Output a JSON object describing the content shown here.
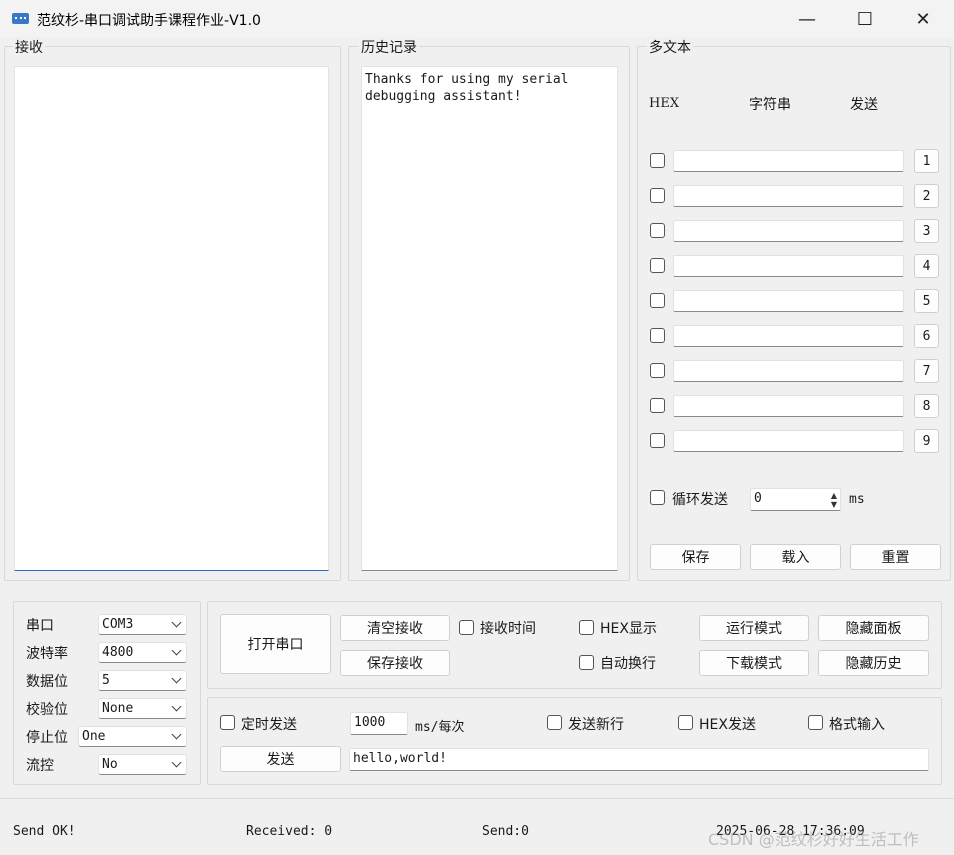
{
  "window": {
    "title": "范纹杉-串口调试助手课程作业-V1.0",
    "minimize": "—",
    "maximize": "☐",
    "close": "✕"
  },
  "receive": {
    "label": "接收",
    "content": ""
  },
  "history": {
    "label": "历史记录",
    "content": "Thanks for using my serial\ndebugging assistant!"
  },
  "multitext": {
    "label": "多文本",
    "col_hex": "HEX",
    "col_string": "字符串",
    "col_send": "发送",
    "rows": [
      {
        "num": "1",
        "value": ""
      },
      {
        "num": "2",
        "value": ""
      },
      {
        "num": "3",
        "value": ""
      },
      {
        "num": "4",
        "value": ""
      },
      {
        "num": "5",
        "value": ""
      },
      {
        "num": "6",
        "value": ""
      },
      {
        "num": "7",
        "value": ""
      },
      {
        "num": "8",
        "value": ""
      },
      {
        "num": "9",
        "value": ""
      }
    ],
    "loop_send_label": "循环发送",
    "loop_interval": "0",
    "loop_unit": "ms",
    "save_btn": "保存",
    "load_btn": "载入",
    "reset_btn": "重置"
  },
  "serial_settings": {
    "port_label": "串口",
    "port_value": "COM3",
    "baud_label": "波特率",
    "baud_value": "4800",
    "databits_label": "数据位",
    "databits_value": "5",
    "parity_label": "校验位",
    "parity_value": "None",
    "stopbits_label": "停止位",
    "stopbits_value": "One",
    "flow_label": "流控",
    "flow_value": "No"
  },
  "controls": {
    "open_port": "打开串口",
    "clear_receive": "清空接收",
    "save_receive": "保存接收",
    "receive_time": "接收时间",
    "hex_display": "HEX显示",
    "auto_wrap": "自动换行",
    "run_mode": "运行模式",
    "download_mode": "下载模式",
    "hide_panel": "隐藏面板",
    "hide_history": "隐藏历史"
  },
  "send_panel": {
    "timed_send": "定时发送",
    "interval": "1000",
    "interval_unit": "ms/每次",
    "send_newline": "发送新行",
    "hex_send": "HEX发送",
    "format_input": "格式输入",
    "send_btn": "发送",
    "send_text": "hello,world!"
  },
  "statusbar": {
    "send_status": "Send OK!",
    "received": "Received: 0",
    "sent": "Send:0",
    "datetime": "2025-06-28 17:36:09",
    "watermark": "CSDN @范纹杉好好生活工作"
  }
}
